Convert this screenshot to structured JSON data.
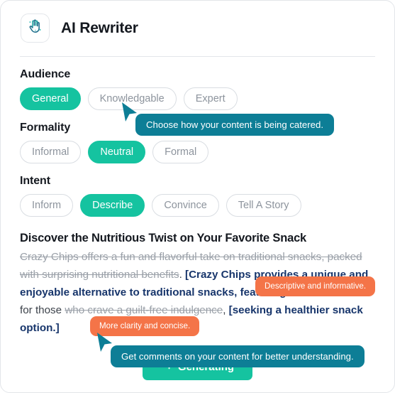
{
  "app": {
    "title": "AI Rewriter",
    "icon": "magic-hand-icon",
    "accent_teal": "#15c3a0",
    "tooltip_teal": "#0d7e96",
    "badge_orange": "#f47448",
    "insert_navy": "#17356b",
    "strike_gray": "#9aa0a8"
  },
  "groups": [
    {
      "label": "Audience",
      "name": "audience",
      "options": [
        {
          "label": "General",
          "active": true
        },
        {
          "label": "Knowledgable",
          "active": false
        },
        {
          "label": "Expert",
          "active": false
        }
      ]
    },
    {
      "label": "Formality",
      "name": "formality",
      "options": [
        {
          "label": "Informal",
          "active": false
        },
        {
          "label": "Neutral",
          "active": true
        },
        {
          "label": "Formal",
          "active": false
        }
      ]
    },
    {
      "label": "Intent",
      "name": "intent",
      "options": [
        {
          "label": "Inform",
          "active": false
        },
        {
          "label": "Describe",
          "active": true
        },
        {
          "label": "Convince",
          "active": false
        },
        {
          "label": "Tell A Story",
          "active": false
        }
      ]
    }
  ],
  "content": {
    "title": "Discover the Nutritious Twist on Your Favorite Snack",
    "segments": [
      {
        "kind": "strike",
        "text": "Crazy Chips offers a fun and flavorful take on traditional snacks, packed with surprising nutritional benefits"
      },
      {
        "kind": "plain",
        "text": ". "
      },
      {
        "kind": "insert",
        "text": "[Crazy Chips provides a unique and enjoyable alternative to traditional snacks, featuring notable"
      },
      {
        "kind": "plain",
        "text": " Perfect for those "
      },
      {
        "kind": "strike",
        "text": "who crave a guilt-free indulgence"
      },
      {
        "kind": "plain",
        "text": ", "
      },
      {
        "kind": "insert",
        "text": "[seeking a healthier snack option.]"
      }
    ]
  },
  "generate_button": {
    "label": "Generating",
    "icon": "sparkle-icon"
  },
  "tooltips": [
    {
      "text": "Choose how your content is being catered.",
      "name": "tooltip-audience"
    },
    {
      "text": "Get comments on your content for better understanding.",
      "name": "tooltip-comments"
    }
  ],
  "comment_badges": [
    {
      "text": "Descriptive and informative.",
      "name": "comment-badge-descriptive"
    },
    {
      "text": "More clarity and concise.",
      "name": "comment-badge-clarity"
    }
  ]
}
